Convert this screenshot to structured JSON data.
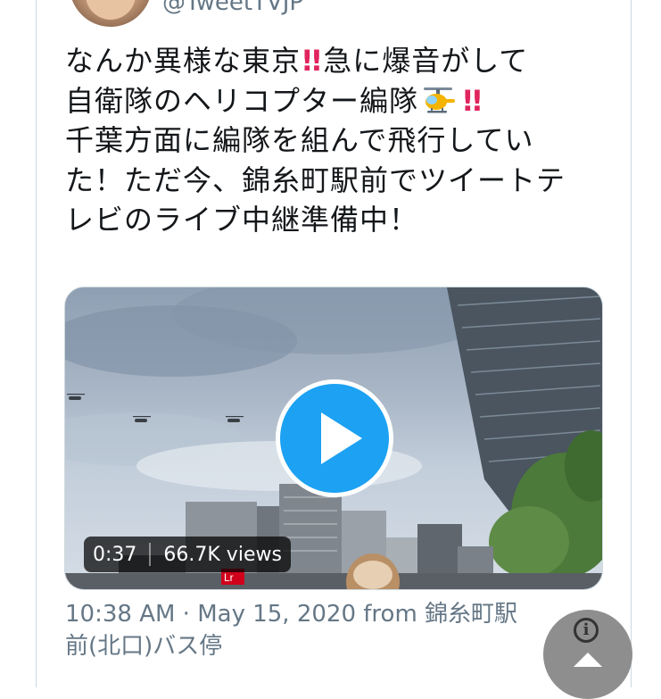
{
  "tweet": {
    "handle": "@TweetTVJP",
    "lines": [
      {
        "text1": "なんか異様な東京",
        "bang": "!!",
        "text2": "急に爆音がして"
      },
      {
        "text1": "自衛隊のヘリコプター編隊",
        "bang": "!!"
      },
      {
        "text1": "千葉方面に編隊を組んで飛行してい"
      },
      {
        "text1": "た！ただ今、錦糸町駅前でツイートテ"
      },
      {
        "text1": "レビのライブ中継準備中！"
      }
    ]
  },
  "media": {
    "duration": "0:37",
    "views": "66.7K views",
    "sign_text": "Lr"
  },
  "meta": {
    "time_date": "10:38 AM · May 15, 2020 from ",
    "source_line1": "錦糸町駅",
    "source_line2": "前(北口)バス停"
  },
  "icons": {
    "avatar": "avatar-image",
    "helicopter": "helicopter-emoji",
    "bang": "double-exclamation-emoji",
    "play": "play-icon",
    "info": "info-icon",
    "scroll_up": "chevron-up-icon"
  },
  "colors": {
    "accent": "#1da1f2",
    "text": "#14171a",
    "muted": "#657786",
    "bang": "#e0245e"
  }
}
